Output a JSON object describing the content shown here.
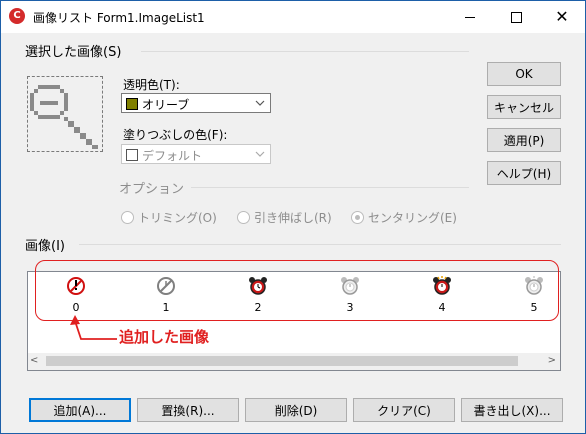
{
  "window": {
    "title": "画像リスト Form1.ImageList1",
    "app_icon": "app-icon",
    "controls": {
      "minimize": "minimize-icon",
      "maximize": "maximize-icon",
      "close": "close-icon",
      "close_glyph": "✕"
    }
  },
  "selected_group": {
    "label": "選択した画像(S)",
    "transparent_label": "透明色(T):",
    "transparent_value": "オリーブ",
    "transparent_color": "#808000",
    "fill_label": "塗りつぶしの色(F):",
    "fill_value": "デフォルト",
    "fill_color": "#ffffff"
  },
  "options": {
    "label": "オプション",
    "trimming": "トリミング(O)",
    "stretch": "引き伸ばし(R)",
    "centering": "センタリング(E)",
    "selected": "centering"
  },
  "images": {
    "label": "画像(I)",
    "items": [
      {
        "index": "0",
        "icon": "no-entry-alarm-icon"
      },
      {
        "index": "1",
        "icon": "gray-clock-icon"
      },
      {
        "index": "2",
        "icon": "red-alarm-clock-icon"
      },
      {
        "index": "3",
        "icon": "faded-alarm-clock-icon"
      },
      {
        "index": "4",
        "icon": "ringing-alarm-clock-icon"
      },
      {
        "index": "5",
        "icon": "faded-ringing-alarm-clock-icon"
      }
    ]
  },
  "annotation": {
    "text": "追加した画像",
    "color": "#e02020"
  },
  "side_buttons": {
    "ok": "OK",
    "cancel": "キャンセル",
    "apply": "適用(P)",
    "help": "ヘルプ(H)"
  },
  "bottom_buttons": {
    "add": "追加(A)...",
    "replace": "置換(R)...",
    "delete": "削除(D)",
    "clear": "クリア(C)",
    "export": "書き出し(X)..."
  },
  "colors": {
    "accent": "#0078d7",
    "annotation": "#e02020",
    "window_bg": "#f0f0f0"
  }
}
